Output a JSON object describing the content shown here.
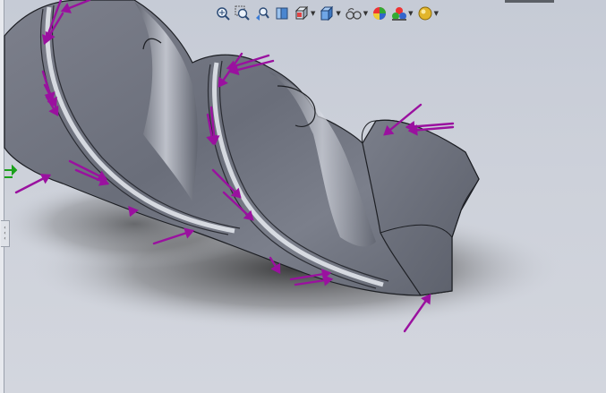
{
  "app": "SolidWorks",
  "toolbar": {
    "items": [
      {
        "name": "zoom-to-fit",
        "icon": "zoom-to-fit-icon"
      },
      {
        "name": "zoom-to-area",
        "icon": "zoom-to-area-icon"
      },
      {
        "name": "previous-view",
        "icon": "previous-view-icon"
      },
      {
        "name": "section-view",
        "icon": "section-view-icon"
      },
      {
        "name": "view-orientation",
        "icon": "view-orientation-icon",
        "dropdown": true
      },
      {
        "name": "display-style",
        "icon": "display-style-icon",
        "dropdown": true
      },
      {
        "name": "hide-show-items",
        "icon": "hide-show-items-icon",
        "dropdown": true
      },
      {
        "name": "edit-appearance",
        "icon": "edit-appearance-icon"
      },
      {
        "name": "apply-scene",
        "icon": "apply-scene-icon",
        "dropdown": true
      },
      {
        "name": "view-settings",
        "icon": "view-settings-icon",
        "dropdown": true
      }
    ]
  },
  "model": {
    "description": "auger-screw-part",
    "body_color": "#6f7380",
    "highlight_color": "#e4e7ee",
    "load_arrow_color": "#9a119f",
    "fixture_arrow_color": "#1aa11a"
  }
}
